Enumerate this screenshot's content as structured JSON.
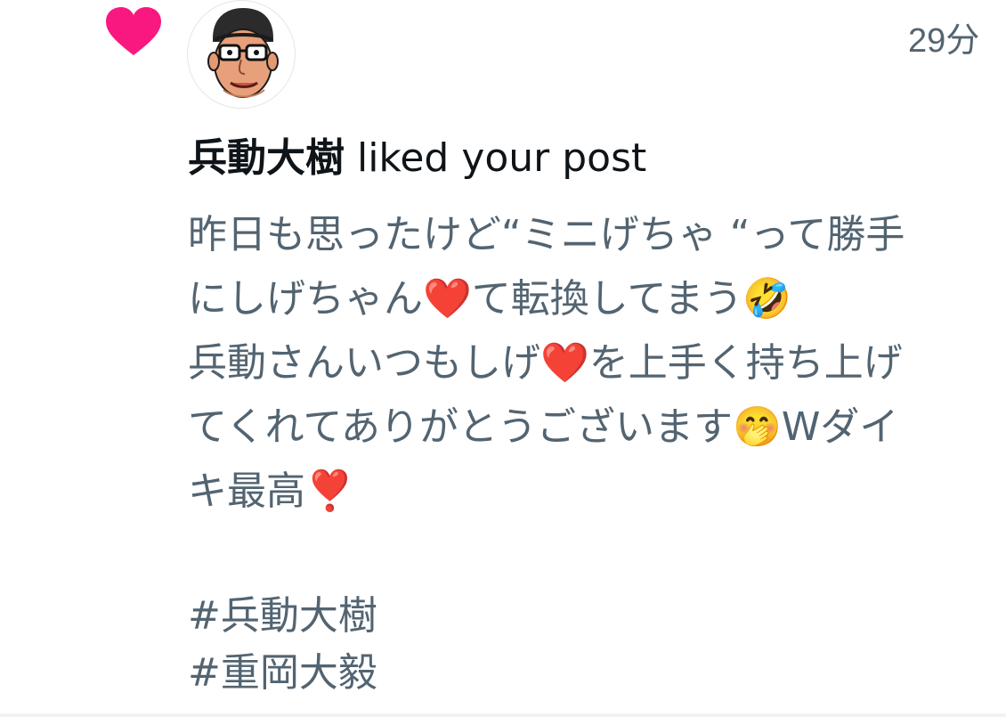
{
  "notification": {
    "type_icon": "heart-icon",
    "icon_color": "#f91880",
    "timestamp": "29分",
    "actor": {
      "name": "兵動大樹",
      "avatar": "cartoon-face-avatar"
    },
    "action_text": " liked your post"
  },
  "post": {
    "lines": [
      "昨日も思ったけど“ミニげちゃ “って勝手",
      "にしげちゃん❤️て転換してまう🤣",
      "兵動さんいつもしげ❤️を上手く持ち上げ",
      "てくれてありがとうございます🤭Wダイ",
      "キ最高❣️"
    ],
    "hashtags": [
      "#兵動大樹",
      "#重岡大毅"
    ]
  },
  "colors": {
    "primary_text": "#0f1419",
    "secondary_text": "#536471",
    "like_pink": "#f91880"
  }
}
